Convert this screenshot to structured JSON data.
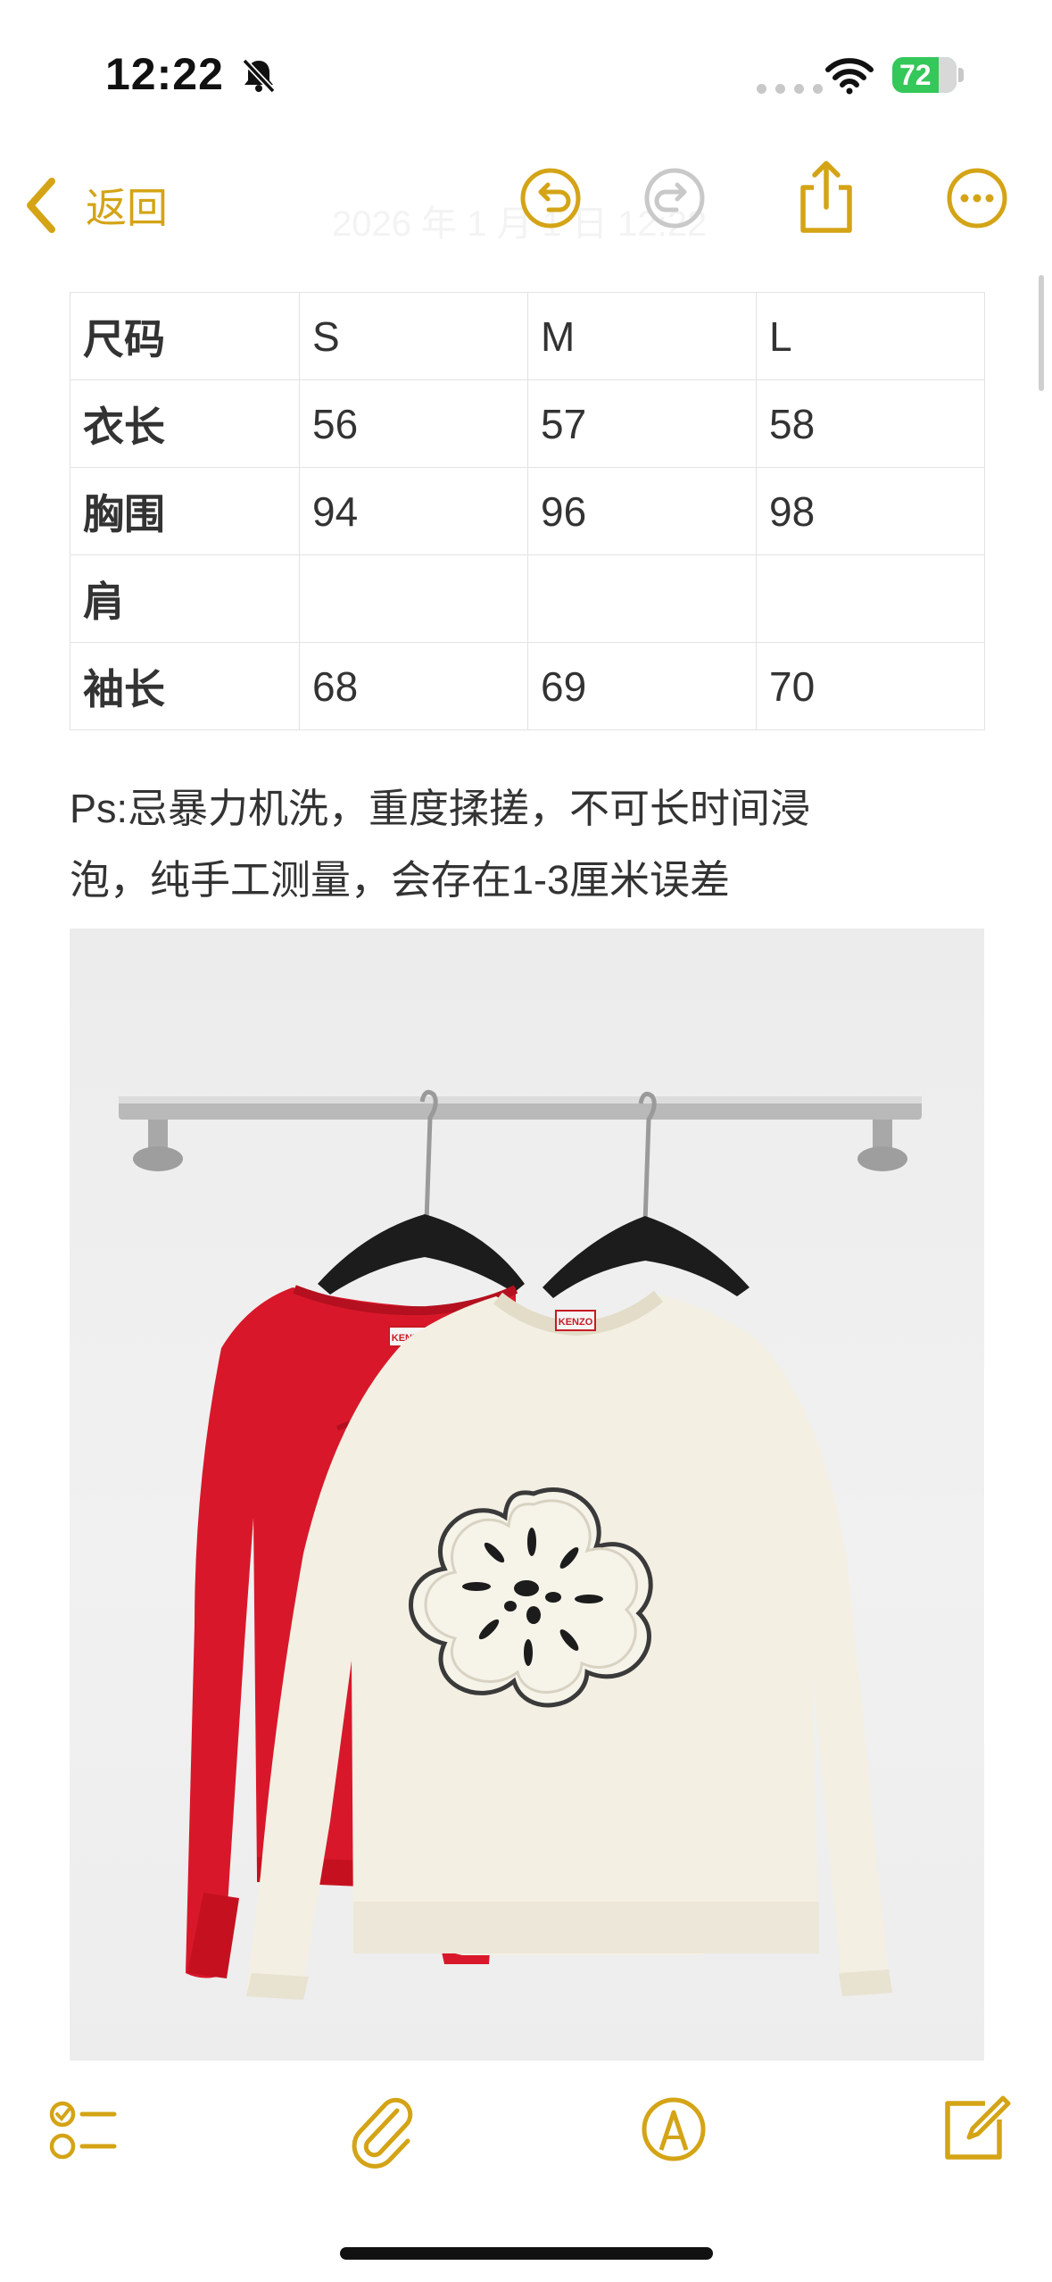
{
  "status_bar": {
    "time": "12:22",
    "battery": "72",
    "icons": [
      "bell-slash-icon",
      "wifi-icon",
      "battery-icon"
    ]
  },
  "nav": {
    "back_label": "返回",
    "faded_date": "2026 年 1 月 1 日 12:22",
    "icons": [
      "chevron-left-icon",
      "undo-icon",
      "redo-icon",
      "share-icon",
      "more-icon"
    ],
    "accent_color": "#d4a416",
    "disabled_color": "#c9c9c9"
  },
  "size_table": {
    "headers": [
      "尺码",
      "S",
      "M",
      "L"
    ],
    "rows": [
      [
        "衣长",
        "56",
        "57",
        "58"
      ],
      [
        "胸围",
        "94",
        "96",
        "98"
      ],
      [
        "肩",
        "",
        "",
        ""
      ],
      [
        "袖长",
        "68",
        "69",
        "70"
      ]
    ]
  },
  "note": {
    "line1": "Ps:忌暴力机洗，重度揉搓，不可长时间浸",
    "line2": "泡，纯手工测量，会存在1-3厘米误差"
  },
  "photo": {
    "label_left": "KENZO",
    "label_right": "KENZO",
    "colors": {
      "red_sweater": "#d8182a",
      "cream_sweater": "#f3efe3"
    }
  },
  "toolbar": {
    "icons": [
      "checklist-icon",
      "attachment-icon",
      "markup-icon",
      "compose-icon"
    ]
  }
}
